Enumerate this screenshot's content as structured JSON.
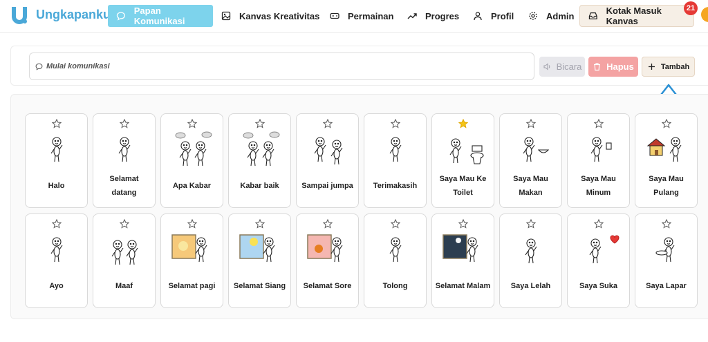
{
  "app": {
    "name": "Ungkapanku"
  },
  "nav": {
    "items": [
      {
        "label": "Papan Komunikasi",
        "icon": "chat-bubble-icon",
        "active": true
      },
      {
        "label": "Kanvas Kreativitas",
        "icon": "image-icon"
      },
      {
        "label": "Permainan",
        "icon": "gamepad-icon"
      },
      {
        "label": "Progres",
        "icon": "trending-up-icon"
      },
      {
        "label": "Profil",
        "icon": "user-icon"
      },
      {
        "label": "Admin",
        "icon": "gear-icon"
      }
    ],
    "inbox": {
      "label": "Kotak Masuk Kanvas",
      "icon": "inbox-icon",
      "badge": "21"
    }
  },
  "toolbar": {
    "placeholder": "Mulai komunikasi",
    "speak_label": "Bicara",
    "delete_label": "Hapus",
    "add_label": "Tambah"
  },
  "colors": {
    "brand": "#4aa8d8",
    "nav_active": "#7dd3ec",
    "delete": "#f4a3a3",
    "badge": "#e53935",
    "star_filled": "#f5c518"
  },
  "cards": [
    {
      "label": "Halo",
      "favorite": false,
      "image": "waving-stick-figure"
    },
    {
      "label": "Selamat datang",
      "favorite": false,
      "image": "welcoming-stick-figure"
    },
    {
      "label": "Apa Kabar",
      "favorite": false,
      "image": "two-figures-speech-bubbles"
    },
    {
      "label": "Kabar baik",
      "favorite": false,
      "image": "two-figures-speech-bubbles"
    },
    {
      "label": "Sampai jumpa",
      "favorite": false,
      "image": "two-figures-goodbye"
    },
    {
      "label": "Terimakasih",
      "favorite": false,
      "image": "thankful-stick-figure"
    },
    {
      "label": "Saya Mau Ke Toilet",
      "favorite": true,
      "image": "figure-with-toilet"
    },
    {
      "label": "Saya Mau Makan",
      "favorite": false,
      "image": "figure-with-bowl"
    },
    {
      "label": "Saya Mau Minum",
      "favorite": false,
      "image": "figure-with-cup"
    },
    {
      "label": "Saya Mau Pulang",
      "favorite": false,
      "image": "figure-with-house"
    },
    {
      "label": "Ayo",
      "favorite": false,
      "image": "beckoning-stick-figure"
    },
    {
      "label": "Maaf",
      "favorite": false,
      "image": "two-figures-apology"
    },
    {
      "label": "Selamat pagi",
      "favorite": false,
      "image": "window-morning-figure"
    },
    {
      "label": "Selamat Siang",
      "favorite": false,
      "image": "window-noon-figure"
    },
    {
      "label": "Selamat Sore",
      "favorite": false,
      "image": "window-evening-figure"
    },
    {
      "label": "Tolong",
      "favorite": false,
      "image": "help-stick-figure"
    },
    {
      "label": "Selamat Malam",
      "favorite": false,
      "image": "window-night-figure"
    },
    {
      "label": "Saya Lelah",
      "favorite": false,
      "image": "tired-stick-figure"
    },
    {
      "label": "Saya Suka",
      "favorite": false,
      "image": "figure-with-heart"
    },
    {
      "label": "Saya Lapar",
      "favorite": false,
      "image": "figure-with-plate"
    }
  ]
}
